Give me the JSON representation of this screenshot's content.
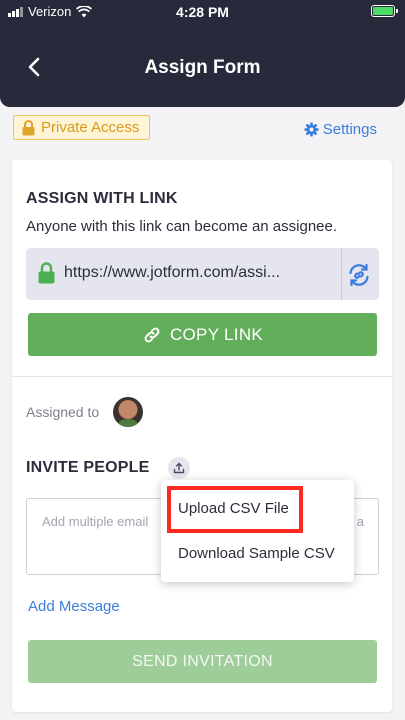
{
  "status_bar": {
    "carrier": "Verizon",
    "time": "4:28 PM"
  },
  "header": {
    "title": "Assign Form"
  },
  "top": {
    "private_access_label": "Private Access",
    "settings_label": "Settings"
  },
  "assign_with_link": {
    "title": "ASSIGN WITH LINK",
    "description": "Anyone with this link can become an assignee.",
    "link_text": "https://www.jotform.com/assi...",
    "copy_button_label": "COPY LINK"
  },
  "assigned": {
    "label": "Assigned to"
  },
  "invite": {
    "title": "INVITE PEOPLE",
    "email_placeholder_start": "Add multiple email",
    "email_placeholder_tail": "a",
    "add_message_label": "Add Message",
    "send_button_label": "SEND INVITATION"
  },
  "upload_menu": {
    "items": [
      "Upload CSV File",
      "Download Sample CSV"
    ]
  },
  "colors": {
    "header_bg": "#262a3b",
    "accent_blue": "#3b7ddd",
    "copy_green": "#63ae5b",
    "send_green_disabled": "#9fcd99",
    "highlight_red": "#ff2a1f",
    "private_badge_amber": "#d99a1e"
  },
  "icons": [
    "wifi-icon",
    "battery-icon",
    "back-chevron-icon",
    "lock-icon",
    "gear-icon",
    "refresh-link-icon",
    "link-icon",
    "upload-icon"
  ]
}
